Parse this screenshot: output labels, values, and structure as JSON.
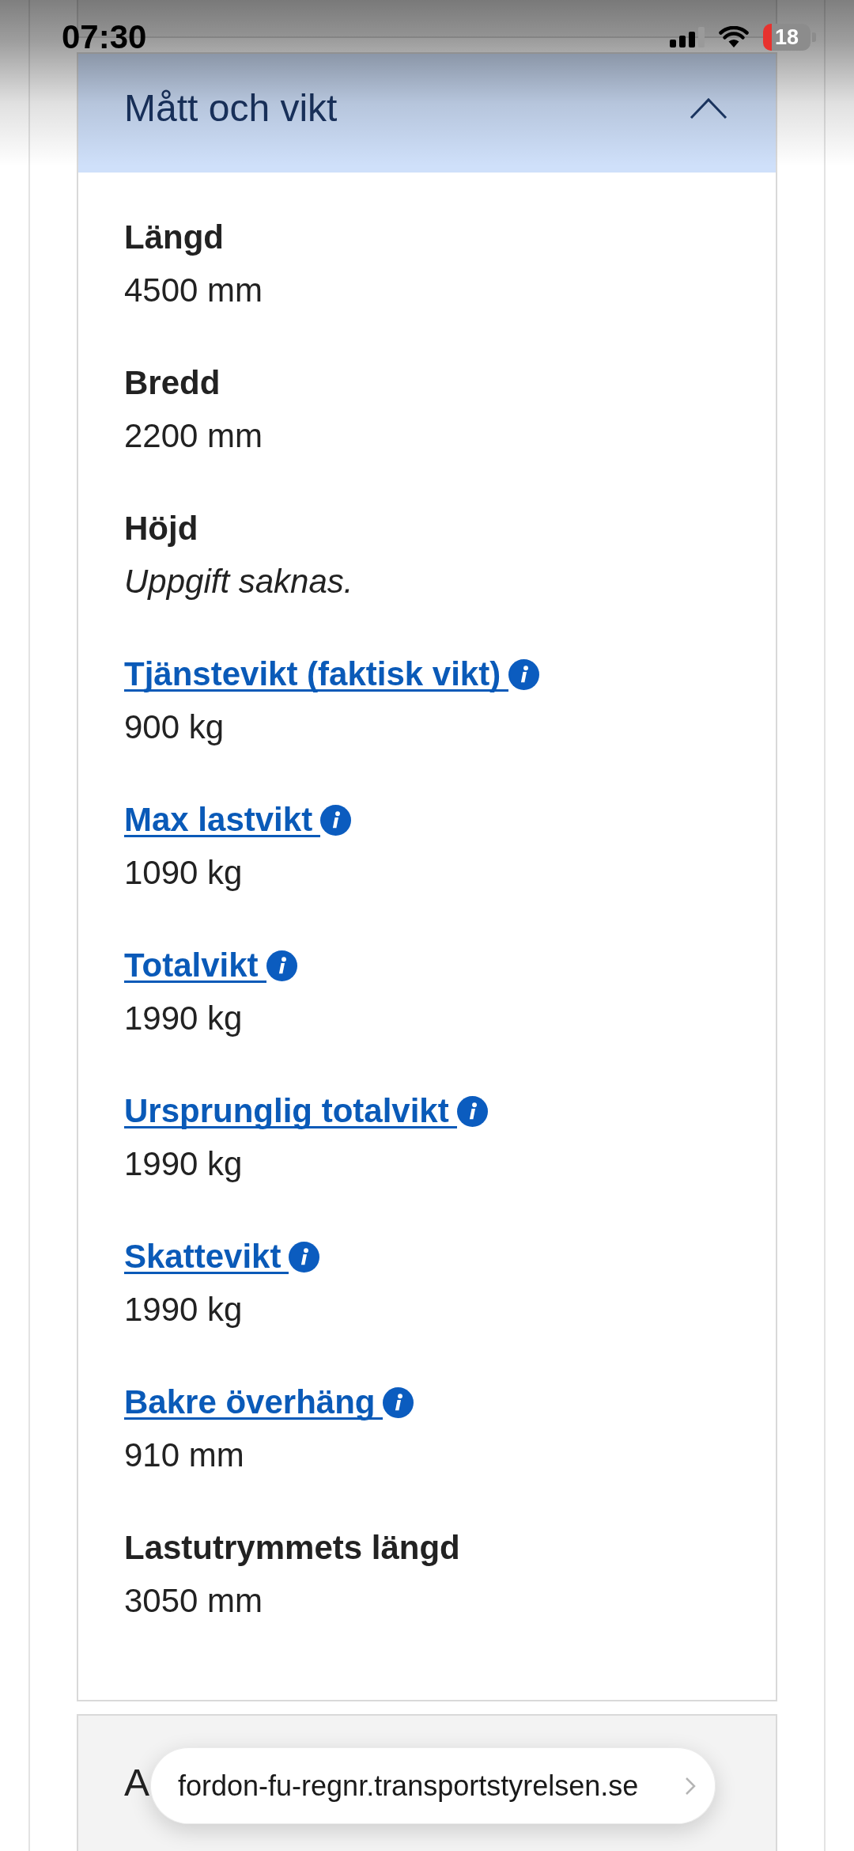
{
  "status_bar": {
    "time": "07:30",
    "battery": "18"
  },
  "section": {
    "title": "Mått och vikt",
    "expanded": true,
    "fields": [
      {
        "kind": "plain",
        "label": "Längd",
        "value": "4500 mm",
        "missing": false
      },
      {
        "kind": "plain",
        "label": "Bredd",
        "value": "2200 mm",
        "missing": false
      },
      {
        "kind": "plain",
        "label": "Höjd",
        "value": "Uppgift saknas.",
        "missing": true
      },
      {
        "kind": "link",
        "label": "Tjänstevikt (faktisk vikt)",
        "value": "900 kg",
        "missing": false
      },
      {
        "kind": "link",
        "label": "Max lastvikt",
        "value": "1090 kg",
        "missing": false
      },
      {
        "kind": "link",
        "label": "Totalvikt",
        "value": "1990 kg",
        "missing": false
      },
      {
        "kind": "link",
        "label": "Ursprunglig totalvikt",
        "value": "1990 kg",
        "missing": false
      },
      {
        "kind": "link",
        "label": "Skattevikt",
        "value": "1990 kg",
        "missing": false
      },
      {
        "kind": "link",
        "label": "Bakre överhäng",
        "value": "910 mm",
        "missing": false
      },
      {
        "kind": "plain",
        "label": "Lastutrymmets längd",
        "value": "3050 mm",
        "missing": false
      }
    ]
  },
  "next_section": {
    "title": "A"
  },
  "address_bar": {
    "url": "fordon-fu-regnr.transportstyrelsen.se"
  }
}
